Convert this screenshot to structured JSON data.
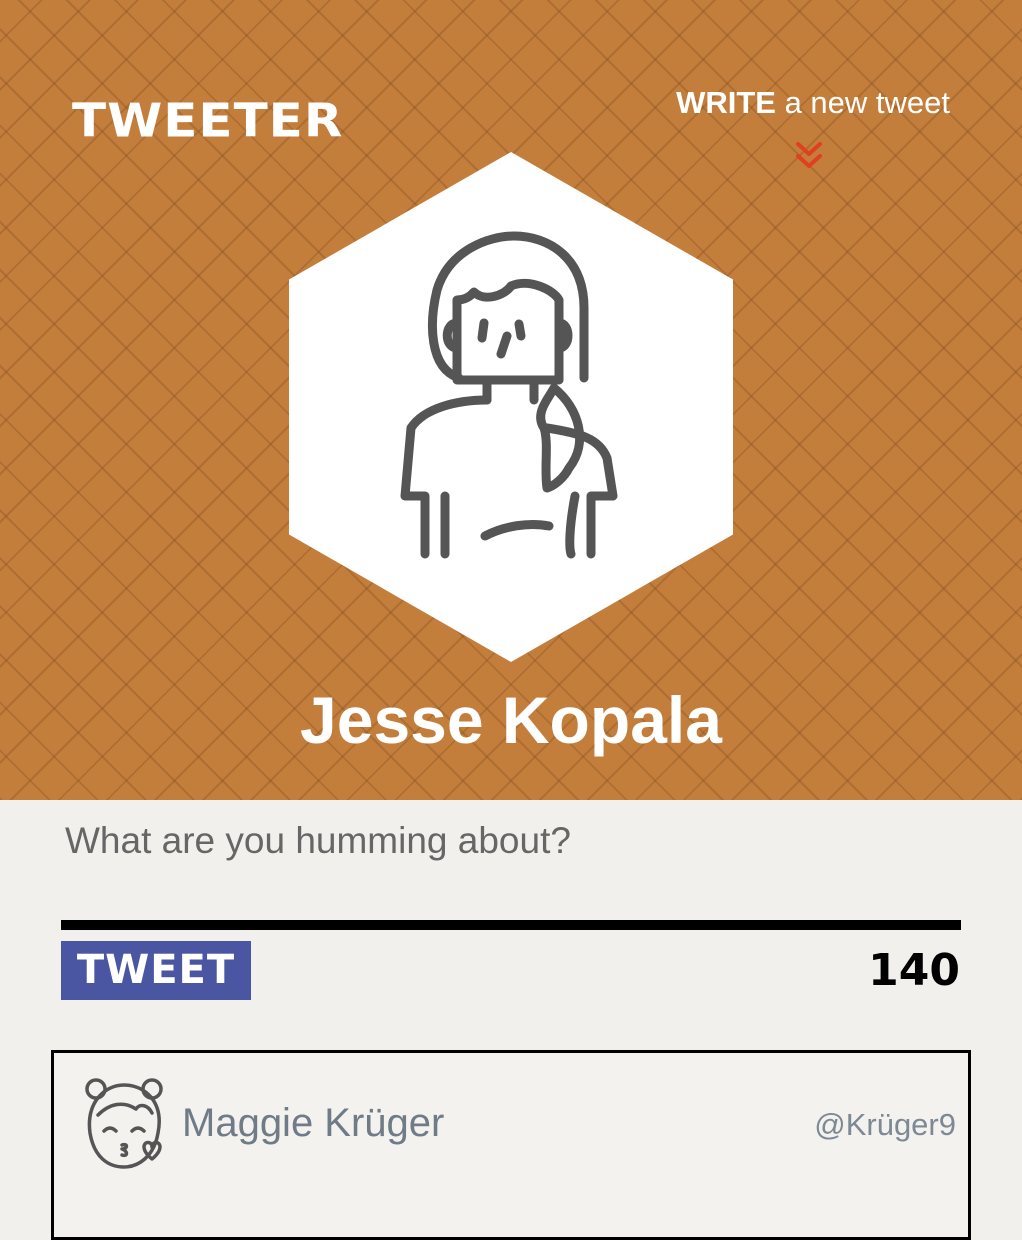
{
  "header": {
    "logo": "TWEETER",
    "write_link": {
      "strong": "WRITE",
      "rest": " a new tweet"
    },
    "background_color": "#c37e3c",
    "chevron_color": "#e0401f"
  },
  "profile": {
    "name": "Jesse Kopala",
    "avatar_icon": "woman-avatar-icon"
  },
  "composer": {
    "placeholder": "What are you humming about?",
    "tweet_button": "TWEET",
    "char_count": "140",
    "button_color": "#4a56a2"
  },
  "tweets": [
    {
      "name": "Maggie Krüger",
      "handle": "@Krüger9",
      "avatar_icon": "girl-kiss-avatar-icon"
    }
  ]
}
